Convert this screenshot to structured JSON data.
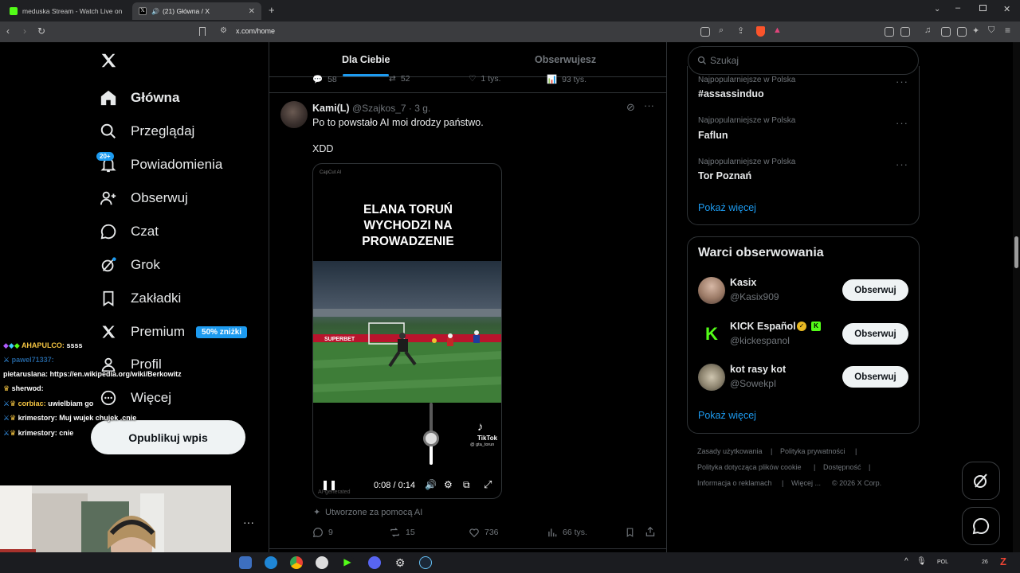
{
  "browser": {
    "tabs": [
      {
        "label": "meduska Stream - Watch Live on Kic",
        "active": false
      },
      {
        "label": "(21) Główna / X",
        "active": true
      }
    ],
    "url": "x.com/home"
  },
  "sidebar": {
    "items": [
      {
        "label": "Główna",
        "icon": "home-icon"
      },
      {
        "label": "Przeglądaj",
        "icon": "search-icon"
      },
      {
        "label": "Powiadomienia",
        "icon": "bell-icon"
      },
      {
        "label": "Obserwuj",
        "icon": "add-person-icon"
      },
      {
        "label": "Czat",
        "icon": "chat-icon"
      },
      {
        "label": "Grok",
        "icon": "grok-icon"
      },
      {
        "label": "Zakładki",
        "icon": "bookmark-icon"
      },
      {
        "label": "Premium",
        "icon": "x-logo-icon"
      },
      {
        "label": "Profil",
        "icon": "person-icon"
      },
      {
        "label": "Więcej",
        "icon": "more-icon"
      }
    ],
    "notifications_badge": "20+",
    "premium_badge": "50% zniżki",
    "post_button": "Opublikuj wpis"
  },
  "feed": {
    "tabs": [
      "Dla Ciebie",
      "Obserwujesz"
    ],
    "prev_post_stats": {
      "replies": "58",
      "reposts": "52",
      "likes": "1 tys.",
      "views": "93 tys."
    },
    "post": {
      "author": "Kami(L)",
      "handle": "@Szajkos_7 · 3 g.",
      "text_line1": "Po to powstało AI moi drodzy państwo.",
      "text_line2": "XDD",
      "video": {
        "corner_label": "CapCut AI",
        "title_lines": [
          "ELANA TORUŃ",
          "WYCHODZI NA",
          "PROWADZENIE"
        ],
        "tiktok_label": "TikTok",
        "tiktok_handle": "@ gta_torun",
        "banner": "SUPERBET",
        "watermark": "AI-generated",
        "time": "0:08 / 0:14"
      },
      "ai_note": "Utworzone za pomocą AI",
      "stats": {
        "replies": "9",
        "reposts": "15",
        "likes": "736",
        "views": "66 tys."
      }
    }
  },
  "right": {
    "search_placeholder": "Szukaj",
    "trends": [
      {
        "meta": "Najpopularniejsze w Polska",
        "name": "#assassinduo"
      },
      {
        "meta": "Najpopularniejsze w Polska",
        "name": "Faflun"
      },
      {
        "meta": "Najpopularniejsze w Polska",
        "name": "Tor Poznań"
      }
    ],
    "trends_more": "Pokaż więcej",
    "who_title": "Warci obserwowania",
    "who": [
      {
        "name": "Kasix",
        "handle": "@Kasix909",
        "button": "Obserwuj"
      },
      {
        "name": "KICK Español",
        "handle": "@kickespanol",
        "button": "Obserwuj"
      },
      {
        "name": "kot rasy kot",
        "handle": "@SowekpI",
        "button": "Obserwuj"
      }
    ],
    "who_more": "Pokaż więcej",
    "footer": {
      "terms": "Zasady użytkowania",
      "privacy": "Polityka prywatności",
      "cookies": "Polityka dotycząca plików cookie",
      "accessibility": "Dostępność",
      "ads": "Informacja o reklamach",
      "more": "Więcej ...",
      "copyright": "© 2026 X Corp.",
      "sep": "|"
    }
  },
  "stream_chat": [
    {
      "user": "AHAPULCO:",
      "msg": "ssss",
      "color": "#f5c542"
    },
    {
      "user": "pawel71337:",
      "msg": "",
      "color": "#3aa0ff"
    },
    {
      "user": "pietaruslana:",
      "msg": "https://en.wikipedia.org/wiki/Berkowitz",
      "color": "#ffffff"
    },
    {
      "user": "sherwod:",
      "msg": "",
      "color": "#ffffff"
    },
    {
      "user": "corbiac:",
      "msg": "uwielbiam go",
      "color": "#f5c542"
    },
    {
      "user": "krimestory:",
      "msg": "Muj wujek chujek",
      "msg2": ".cnie",
      "color": "#ffffff"
    },
    {
      "user": "krimestory:",
      "msg": "cnie",
      "color": "#ffffff"
    }
  ],
  "taskbar": {
    "lang": "POL",
    "clock_fragment": "26"
  },
  "colors": {
    "accent": "#1d9bf0",
    "bg": "#000000",
    "border": "#2f3336",
    "muted": "#71767b"
  }
}
